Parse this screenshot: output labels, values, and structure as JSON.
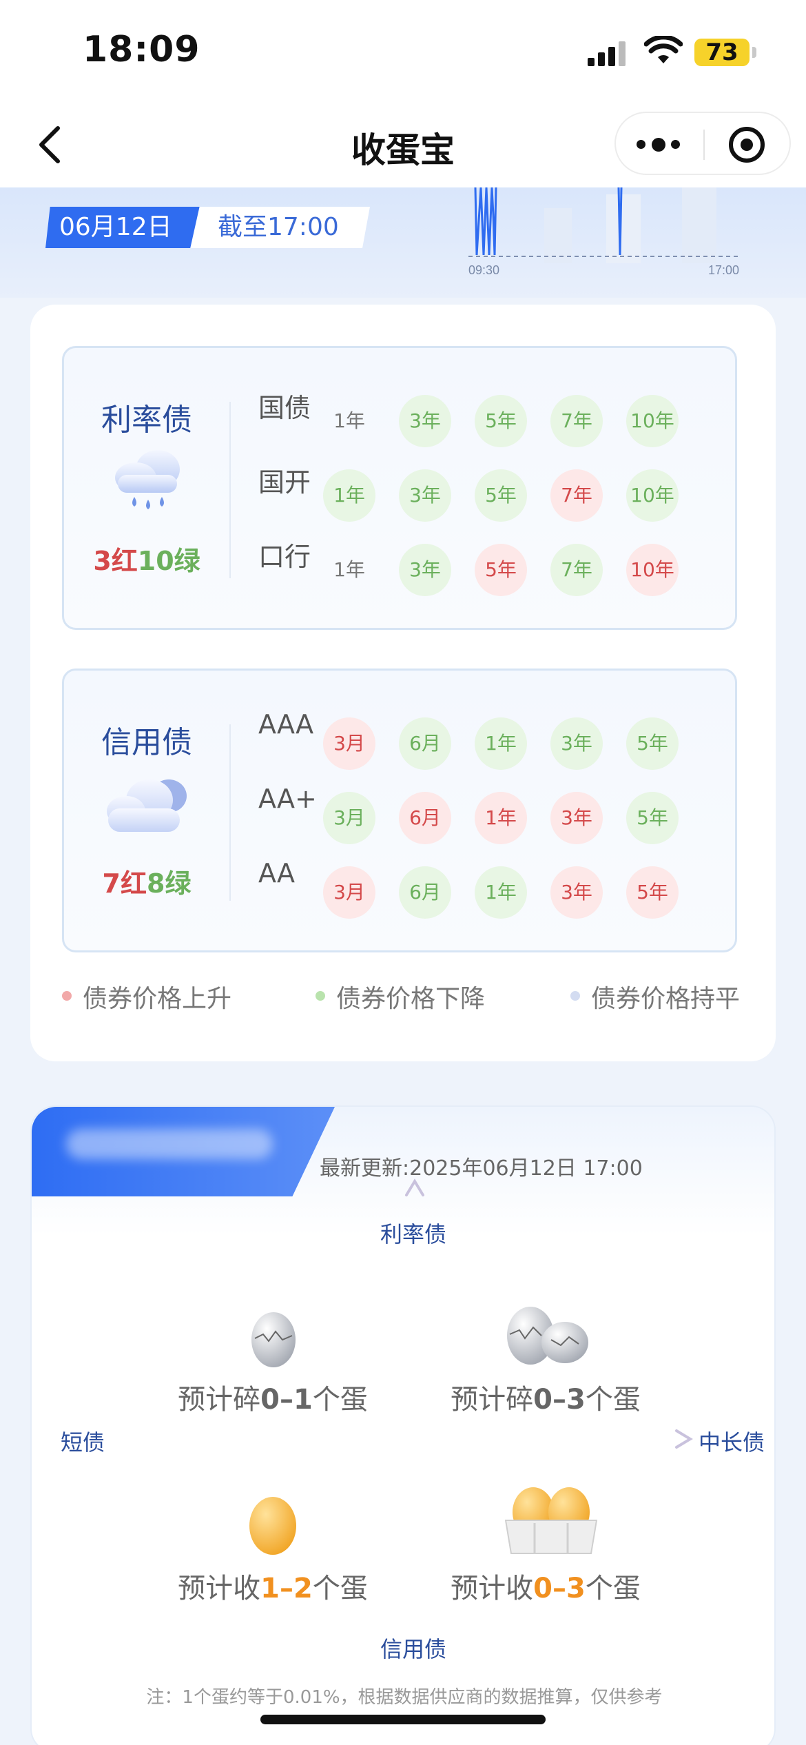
{
  "status_bar": {
    "time": "18:09",
    "battery": "73"
  },
  "nav": {
    "title": "收蛋宝"
  },
  "header": {
    "date": "06月12日",
    "as_of": "截至17:00",
    "chart_start": "09:30",
    "chart_end": "17:00"
  },
  "rate_bonds": {
    "title": "利率债",
    "summary_red": "3红",
    "summary_green": "10绿",
    "weather_icon": "rain-cloud-icon",
    "rows": [
      {
        "label": "国债",
        "cells": [
          {
            "t": "1年",
            "s": "flat"
          },
          {
            "t": "3年",
            "s": "down"
          },
          {
            "t": "5年",
            "s": "down"
          },
          {
            "t": "7年",
            "s": "down"
          },
          {
            "t": "10年",
            "s": "down"
          }
        ]
      },
      {
        "label": "国开",
        "cells": [
          {
            "t": "1年",
            "s": "down"
          },
          {
            "t": "3年",
            "s": "down"
          },
          {
            "t": "5年",
            "s": "down"
          },
          {
            "t": "7年",
            "s": "up"
          },
          {
            "t": "10年",
            "s": "down"
          }
        ]
      },
      {
        "label": "口行",
        "cells": [
          {
            "t": "1年",
            "s": "flat"
          },
          {
            "t": "3年",
            "s": "down"
          },
          {
            "t": "5年",
            "s": "up"
          },
          {
            "t": "7年",
            "s": "down"
          },
          {
            "t": "10年",
            "s": "up"
          }
        ]
      }
    ]
  },
  "credit_bonds": {
    "title": "信用债",
    "summary_red": "7红",
    "summary_green": "8绿",
    "weather_icon": "cloudy-icon",
    "rows": [
      {
        "label": "AAA",
        "cells": [
          {
            "t": "3月",
            "s": "up"
          },
          {
            "t": "6月",
            "s": "down"
          },
          {
            "t": "1年",
            "s": "down"
          },
          {
            "t": "3年",
            "s": "down"
          },
          {
            "t": "5年",
            "s": "down"
          }
        ]
      },
      {
        "label": "AA+",
        "cells": [
          {
            "t": "3月",
            "s": "down"
          },
          {
            "t": "6月",
            "s": "up"
          },
          {
            "t": "1年",
            "s": "up"
          },
          {
            "t": "3年",
            "s": "up"
          },
          {
            "t": "5年",
            "s": "down"
          }
        ]
      },
      {
        "label": "AA",
        "cells": [
          {
            "t": "3月",
            "s": "up"
          },
          {
            "t": "6月",
            "s": "down"
          },
          {
            "t": "1年",
            "s": "down"
          },
          {
            "t": "3年",
            "s": "up"
          },
          {
            "t": "5年",
            "s": "up"
          }
        ]
      }
    ]
  },
  "legend": {
    "up": "债券价格上升",
    "down": "债券价格下降",
    "flat": "债券价格持平",
    "colors": {
      "up": "#f2a9a9",
      "down": "#b9e3ad",
      "flat": "#d3dcf1"
    }
  },
  "egg": {
    "updated": "最新更新:2025年06月12日 17:00",
    "axis_top": "利率债",
    "axis_bottom": "信用债",
    "axis_left": "短债",
    "axis_right": "中长债",
    "q_tl_pre": "预计碎",
    "q_tl_num": "0–1",
    "q_tl_post": "个蛋",
    "q_tr_pre": "预计碎",
    "q_tr_num": "0–3",
    "q_tr_post": "个蛋",
    "q_bl_pre": "预计收",
    "q_bl_num": "1–2",
    "q_bl_post": "个蛋",
    "q_br_pre": "预计收",
    "q_br_num": "0–3",
    "q_br_post": "个蛋",
    "note": "注：1个蛋约等于0.01%，根据数据供应商的数据推算，仅供参考"
  }
}
